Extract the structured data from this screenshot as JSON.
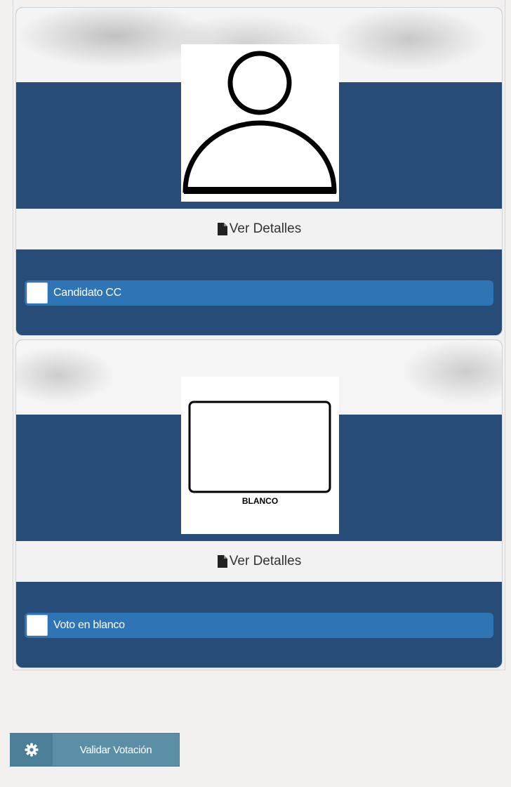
{
  "candidates": [
    {
      "details_label": "Ver Detalles",
      "option_label": "Candidato CC",
      "photo_icon": "person-silhouette-icon",
      "photo_caption": ""
    },
    {
      "details_label": "Ver Detalles",
      "option_label": "Voto en blanco",
      "photo_icon": "blank-ballot-icon",
      "photo_caption": "BLANCO"
    }
  ],
  "actions": {
    "validate_label": "Validar Votación",
    "validate_icon": "gear-icon"
  },
  "colors": {
    "card_blue": "#284c78",
    "option_blue": "#2f74b5",
    "button_teal": "#5b8fa6"
  }
}
